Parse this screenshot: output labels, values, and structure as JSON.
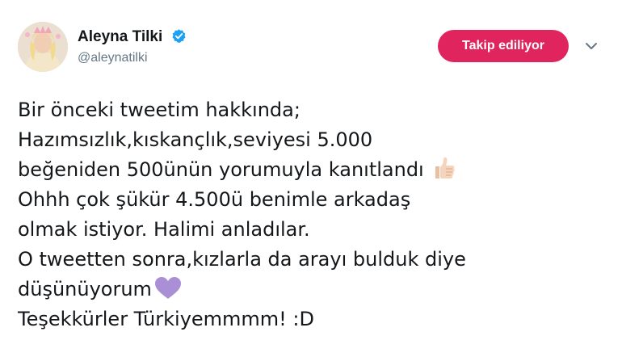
{
  "author": {
    "display_name": "Aleyna Tilki",
    "handle": "@aleynatilki",
    "verified_icon": "verified-badge-icon",
    "avatar_icon": "profile-photo"
  },
  "follow_button": {
    "label": "Takip ediliyor",
    "color": "#e0245e"
  },
  "menu": {
    "icon": "chevron-down-icon"
  },
  "tweet": {
    "lines": [
      "Bir önceki tweetim hakkında;",
      "Hazımsızlık,kıskançlık,seviyesi 5.000",
      "beğeniden 500ünün yorumuyla kanıtlandı",
      "Ohhh çok şükür 4.500ü benimle arkadaş",
      "olmak istiyor. Halimi anladılar.",
      "O tweetten sonra,kızlarla da arayı bulduk diye",
      "düşünüyorum",
      "Teşekkürler Türkiyemmmm! :D"
    ],
    "emojis": {
      "line_3": "thumbs-up-emoji",
      "line_7": "purple-heart-emoji"
    }
  },
  "colors": {
    "text": "#14171a",
    "handle": "#657786",
    "verified": "#1da1f2",
    "heart": "#aa8ed6"
  }
}
